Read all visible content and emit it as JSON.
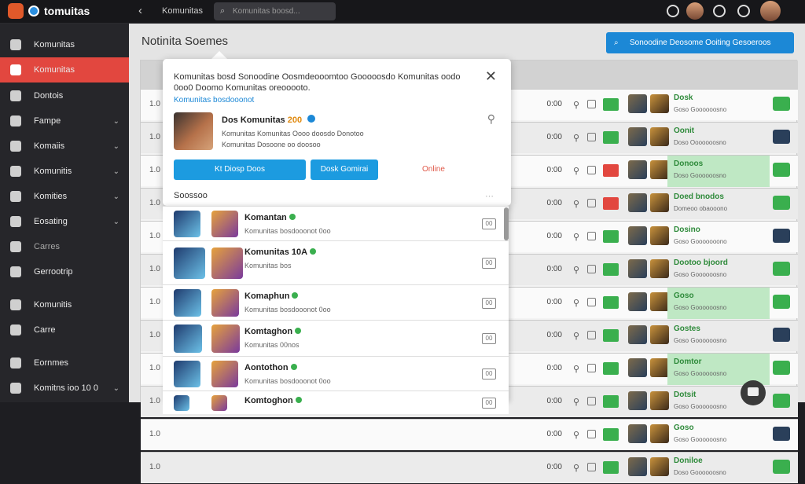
{
  "app": {
    "title": "tomuitas"
  },
  "topbar": {
    "back_label": "‹",
    "breadcrumb": "Komunitas",
    "search_placeholder": "Komunitas boosd..."
  },
  "sidebar": {
    "items": [
      {
        "label": "Komunitas",
        "icon": "heart-icon"
      },
      {
        "label": "Komunitas",
        "icon": "calendar-icon",
        "active": true
      },
      {
        "label": "Dontois",
        "icon": "tag-icon"
      },
      {
        "label": "Fampe",
        "icon": "pen-icon",
        "chevron": "⌄"
      },
      {
        "label": "Komaiis",
        "icon": "wrench-icon",
        "chevron": "⌄"
      },
      {
        "label": "Komunitis",
        "icon": "gear-icon",
        "chevron": "⌄"
      },
      {
        "label": "Komities",
        "icon": "users-icon",
        "chevron": "⌄"
      },
      {
        "label": "Eosating",
        "icon": "square-icon",
        "chevron": "⌄"
      },
      {
        "label": "Carres",
        "icon": "cloud-icon"
      },
      {
        "label": "Gerrootrip",
        "icon": "settings-icon"
      },
      {
        "label": "Komunitis",
        "icon": "coins-icon"
      },
      {
        "label": "Carre",
        "icon": "flag-icon"
      },
      {
        "label": "Eornmes",
        "icon": "calendar-icon"
      },
      {
        "label": "Komitns ioo 10 0",
        "icon": "gear-icon",
        "chevron": "⌄"
      }
    ]
  },
  "main": {
    "title": "Notinita Soemes",
    "action_label": "Sonoodine Deosome Ooiting Gesoeroos"
  },
  "table": {
    "rows": [
      {
        "id": "1.0",
        "time": "0:00",
        "game": "Dosk",
        "sub": "Goso Goooooosno"
      },
      {
        "id": "1.0",
        "time": "0:00",
        "game": "Oonit",
        "sub": "Doso Ooooooosno"
      },
      {
        "id": "1.0",
        "time": "0:00",
        "game": "Donoos",
        "sub": "Doso Goooooosno"
      },
      {
        "id": "1.0",
        "time": "0:00",
        "game": "Doed bnodos",
        "sub": "Domeoo obaooono"
      },
      {
        "id": "1.0",
        "time": "0:00",
        "game": "Dosino",
        "sub": "Goso Gooooooono"
      },
      {
        "id": "1.0",
        "time": "0:00",
        "game": "Dootoo bjoord",
        "sub": "Goso Goooooosno"
      },
      {
        "id": "1.0",
        "time": "0:00",
        "game": "Goso",
        "sub": "Goso Goooooosno"
      },
      {
        "id": "1.0",
        "time": "0:00",
        "game": "Gostes",
        "sub": "Goso Goooooosno"
      },
      {
        "id": "1.0",
        "time": "0:00",
        "game": "Domtor",
        "sub": "Goso Goooooosno"
      },
      {
        "id": "1.0",
        "time": "0:00",
        "game": "Dotsit",
        "sub": "Goso Goooooosno"
      },
      {
        "id": "1.0",
        "time": "0:00",
        "game": "Goso",
        "sub": "Goso Goooooosno"
      },
      {
        "id": "1.0",
        "time": "0:00",
        "game": "Doniloe",
        "sub": "Doso Goooooosno"
      }
    ]
  },
  "modal": {
    "text": "Komunitas bosd Sonoodine Oosmdeooomtoo Gooooosdo Komunitas oodo 0oo0 Doomo Komunitas oreooooto.",
    "link": "Komunitas bosdooonot",
    "name": "Dos Komunitas",
    "name_num": "200",
    "info": "Komunitas Komunitas Oooo doosdo Donotoo Komunitas Dosoone oo doosoo",
    "btn_primary": "Kt Diosp Doos",
    "btn_secondary": "Dosk Gomirai",
    "btn_text": "Online",
    "footer": "Soossoo",
    "footer_right": "⋯"
  },
  "panel": {
    "items": [
      {
        "name": "Komantan",
        "desc": "Komunitas bosdooonot 0oo",
        "badge": "00"
      },
      {
        "name": "Komunitas 10A",
        "desc": "Komunitas bos",
        "badge": "00"
      },
      {
        "name": "Komaphun",
        "desc": "Komunitas bosdooonot 0oo",
        "badge": "00"
      },
      {
        "name": "Komtaghon",
        "desc": "Komunitas 00nos",
        "badge": "00"
      },
      {
        "name": "Aontothon",
        "desc": "Komunitas bosdooonot 0oo",
        "badge": "00"
      },
      {
        "name": "Komtoghon",
        "desc": "",
        "badge": "00"
      }
    ]
  },
  "colors": {
    "accent": "#e2473f",
    "primary": "#1c88d6",
    "success": "#3aaf4e"
  }
}
